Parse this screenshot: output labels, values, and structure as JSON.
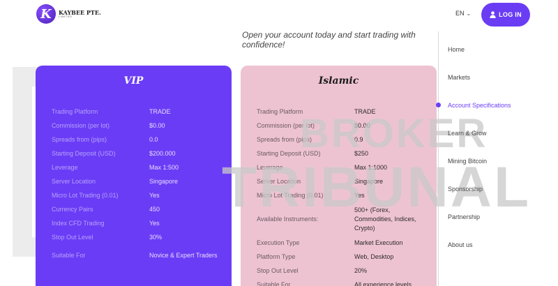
{
  "header": {
    "logo_letter": "K",
    "logo_name": "KAYBEE PTE.",
    "logo_sub": "LIMITED",
    "lang": "EN",
    "login_label": "LOG IN"
  },
  "tagline": "Open your account today and start trading with confidence!",
  "watermark": {
    "line1": "BROKER",
    "line2": "TRIBUNAL"
  },
  "cards": [
    {
      "title": "VIP",
      "rows": [
        {
          "label": "Trading Platform",
          "value": "TRADE"
        },
        {
          "label": "Commission (per lot)",
          "value": "$0.00"
        },
        {
          "label": "Spreads from (pips)",
          "value": "0.0"
        },
        {
          "label": "Starting Deposit (USD)",
          "value": "$200.000"
        },
        {
          "label": "Leverage",
          "value": "Max 1:500"
        },
        {
          "label": "Server Location",
          "value": "Singapore"
        },
        {
          "label": "Micro Lot Trading (0.01)",
          "value": "Yes"
        },
        {
          "label": "Currency Pairs",
          "value": "450"
        },
        {
          "label": "Index CFD Trading",
          "value": "Yes"
        },
        {
          "label": "Stop Out Level",
          "value": "30%"
        },
        {
          "label": "Suitable For",
          "value": "Novice & Expert Traders"
        }
      ]
    },
    {
      "title": "Islamic",
      "rows": [
        {
          "label": "Trading Platform",
          "value": "TRADE"
        },
        {
          "label": "Commission (per lot)",
          "value": "$0.00"
        },
        {
          "label": "Spreads from (pips)",
          "value": "0.9"
        },
        {
          "label": "Starting Deposit (USD)",
          "value": "$250"
        },
        {
          "label": "Leverage",
          "value": "Max 1:1000"
        },
        {
          "label": "Server Location",
          "value": "Singapore"
        },
        {
          "label": "Micro Lot Trading (0.01)",
          "value": "Yes"
        },
        {
          "label": "Available Instruments:",
          "value": "500+ (Forex, Commodities, Indices, Crypto)"
        },
        {
          "label": "Execution Type",
          "value": "Market Execution"
        },
        {
          "label": "Platform Type",
          "value": "Web, Desktop"
        },
        {
          "label": "Stop Out Level",
          "value": "20%"
        },
        {
          "label": "Suitable For",
          "value": "All experience levels"
        }
      ]
    }
  ],
  "nav": [
    {
      "label": "Home",
      "active": false
    },
    {
      "label": "Markets",
      "active": false
    },
    {
      "label": "Account Specifications",
      "active": true
    },
    {
      "label": "Learn & Grow",
      "active": false
    },
    {
      "label": "Mining Bitcoin",
      "active": false
    },
    {
      "label": "Sponsorship",
      "active": false
    },
    {
      "label": "Partnership",
      "active": false
    },
    {
      "label": "About us",
      "active": false
    }
  ],
  "colors": {
    "accent": "#6a3df5",
    "vip_card": "#6b3cf6",
    "islamic_card": "#edc3d2"
  }
}
